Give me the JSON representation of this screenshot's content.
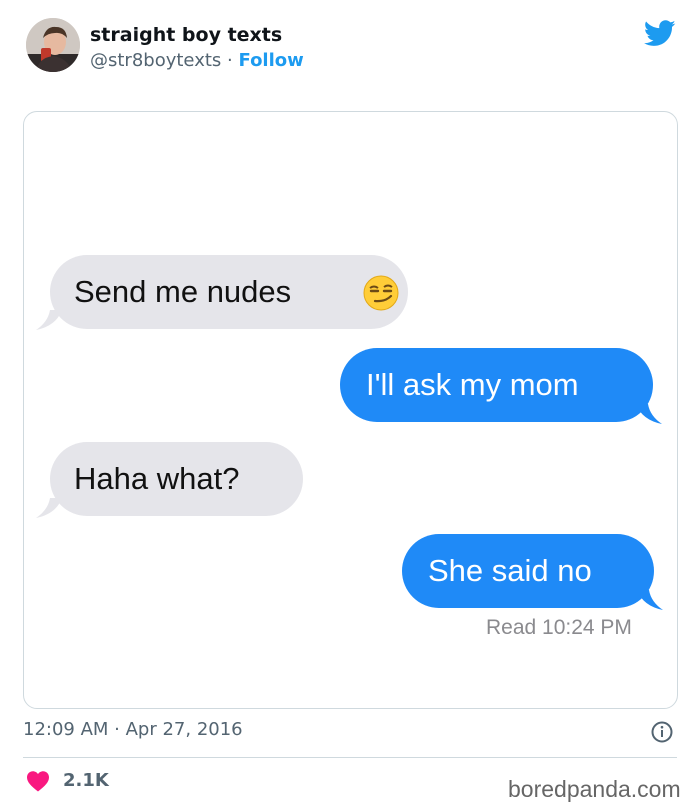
{
  "tweet": {
    "author_name": "straight boy texts",
    "handle": "@str8boytexts",
    "separator": "·",
    "follow_label": "Follow",
    "brand_icon": "twitter-bird-icon",
    "timestamp": "12:09 AM · Apr 27, 2016",
    "likes": "2.1K",
    "colors": {
      "accent": "#1d9bf0",
      "like": "#f91880"
    }
  },
  "conversation": {
    "messages": [
      {
        "sender": "them",
        "text": "Send me nudes",
        "emoji": "smirking-face-icon"
      },
      {
        "sender": "me",
        "text": "I'll ask my mom"
      },
      {
        "sender": "them",
        "text": "Haha what?"
      },
      {
        "sender": "me",
        "text": "She said no"
      }
    ],
    "read_receipt": "Read 10:24 PM",
    "colors": {
      "sent": "#1f8af7",
      "received": "#e5e5ea"
    }
  },
  "watermark": "boredpanda.com"
}
